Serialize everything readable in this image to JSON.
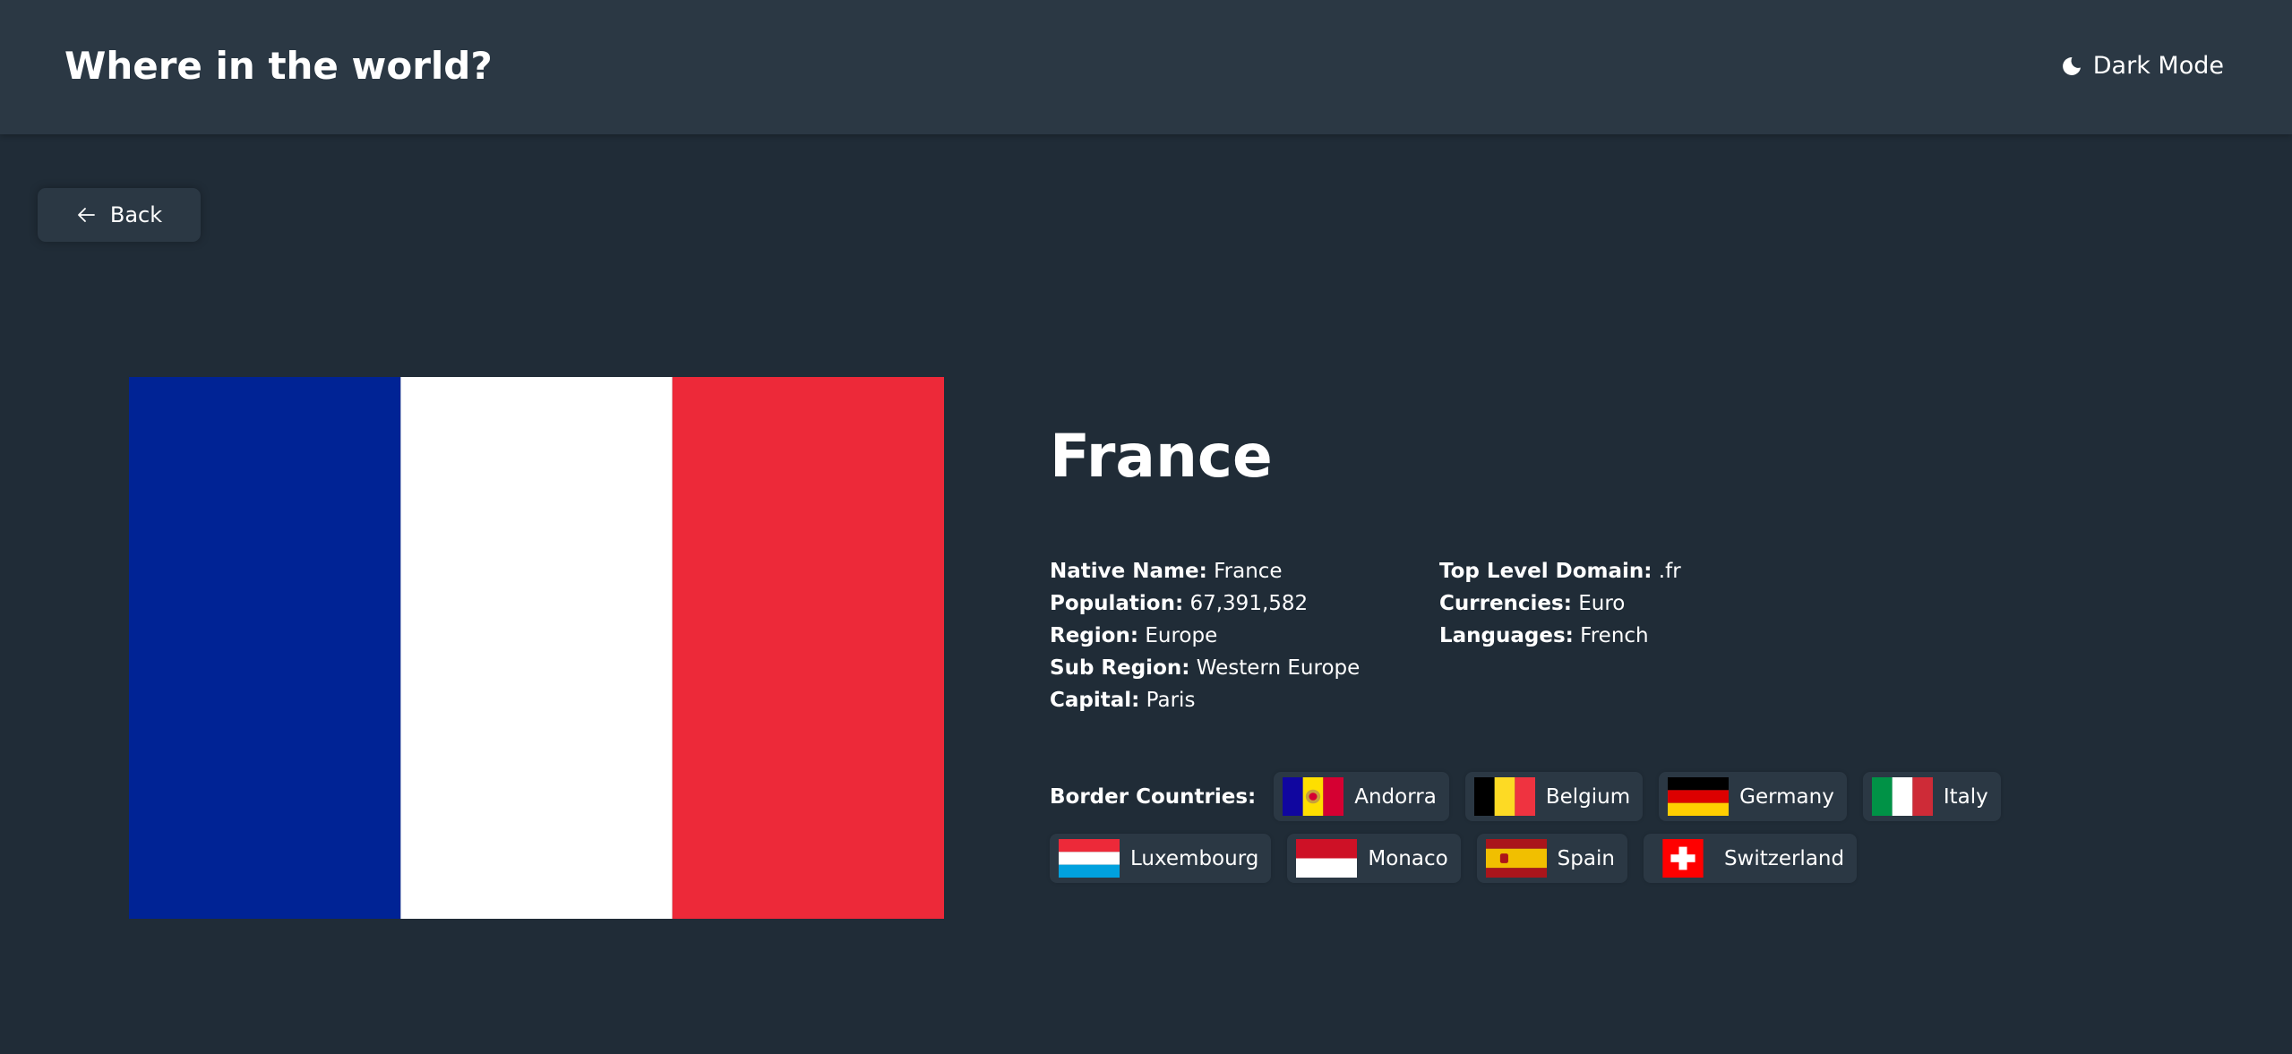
{
  "header": {
    "title": "Where in the world?",
    "mode_label": "Dark Mode"
  },
  "back_label": "Back",
  "country": {
    "name": "France",
    "flag_colors": [
      "#002395",
      "#ffffff",
      "#ed2939"
    ],
    "left_fields": [
      {
        "label": "Native Name:",
        "value": "France"
      },
      {
        "label": "Population:",
        "value": "67,391,582"
      },
      {
        "label": "Region:",
        "value": "Europe"
      },
      {
        "label": "Sub Region:",
        "value": "Western Europe"
      },
      {
        "label": "Capital:",
        "value": "Paris"
      }
    ],
    "right_fields": [
      {
        "label": "Top Level Domain:",
        "value": ".fr"
      },
      {
        "label": "Currencies:",
        "value": "Euro"
      },
      {
        "label": "Languages:",
        "value": "French"
      }
    ]
  },
  "borders": {
    "label": "Border Countries:",
    "countries": [
      {
        "name": "Andorra",
        "flag": "andorra-flag-icon"
      },
      {
        "name": "Belgium",
        "flag": "belgium-flag-icon"
      },
      {
        "name": "Germany",
        "flag": "germany-flag-icon"
      },
      {
        "name": "Italy",
        "flag": "italy-flag-icon"
      },
      {
        "name": "Luxembourg",
        "flag": "luxembourg-flag-icon"
      },
      {
        "name": "Monaco",
        "flag": "monaco-flag-icon"
      },
      {
        "name": "Spain",
        "flag": "spain-flag-icon"
      },
      {
        "name": "Switzerland",
        "flag": "switzerland-flag-icon"
      }
    ]
  },
  "colors": {
    "background": "#202c37",
    "elements": "#2b3844",
    "text": "#ffffff"
  }
}
